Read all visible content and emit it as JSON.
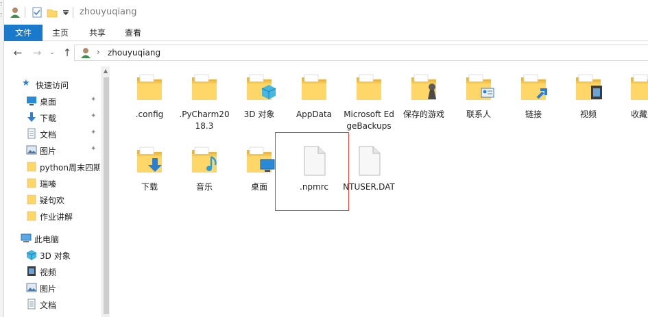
{
  "window": {
    "title": "zhouyuqiang"
  },
  "ribbon": {
    "tabs": [
      "文件",
      "主页",
      "共享",
      "查看"
    ]
  },
  "address": {
    "path": "zhouyuqiang"
  },
  "nav": {
    "quick_access": "快速访问",
    "items": [
      {
        "label": "桌面",
        "pinned": true
      },
      {
        "label": "下载",
        "pinned": true
      },
      {
        "label": "文档",
        "pinned": true
      },
      {
        "label": "图片",
        "pinned": true
      },
      {
        "label": "python周末四期"
      },
      {
        "label": "瑞嗪"
      },
      {
        "label": "疑句欢"
      },
      {
        "label": "作业讲解"
      }
    ],
    "this_pc": "此电脑",
    "pc_items": [
      {
        "label": "3D 对象"
      },
      {
        "label": "视频"
      },
      {
        "label": "图片"
      },
      {
        "label": "文档"
      }
    ]
  },
  "files": [
    {
      "name": ".config",
      "icon": "folder-icon"
    },
    {
      "name": ".PyCharm2018.3",
      "icon": "folder-icon"
    },
    {
      "name": "3D 对象",
      "icon": "folder-3d-icon"
    },
    {
      "name": "AppData",
      "icon": "folder-icon"
    },
    {
      "name": "Microsoft EdgeBackups",
      "icon": "folder-icon"
    },
    {
      "name": "保存的游戏",
      "icon": "folder-games-icon"
    },
    {
      "name": "联系人",
      "icon": "folder-contacts-icon"
    },
    {
      "name": "链接",
      "icon": "folder-links-icon"
    },
    {
      "name": "视频",
      "icon": "folder-video-icon"
    },
    {
      "name": "收藏夹",
      "icon": "folder-favorites-icon"
    },
    {
      "name": "下载",
      "icon": "folder-downloads-icon"
    },
    {
      "name": "音乐",
      "icon": "folder-music-icon"
    },
    {
      "name": "桌面",
      "icon": "folder-desktop-icon"
    },
    {
      "name": ".npmrc",
      "icon": "file-icon"
    },
    {
      "name": "NTUSER.DAT",
      "icon": "file-icon"
    }
  ],
  "colors": {
    "accent": "#1979ca",
    "folder": "#ffd768",
    "selection": "#e0453e"
  }
}
